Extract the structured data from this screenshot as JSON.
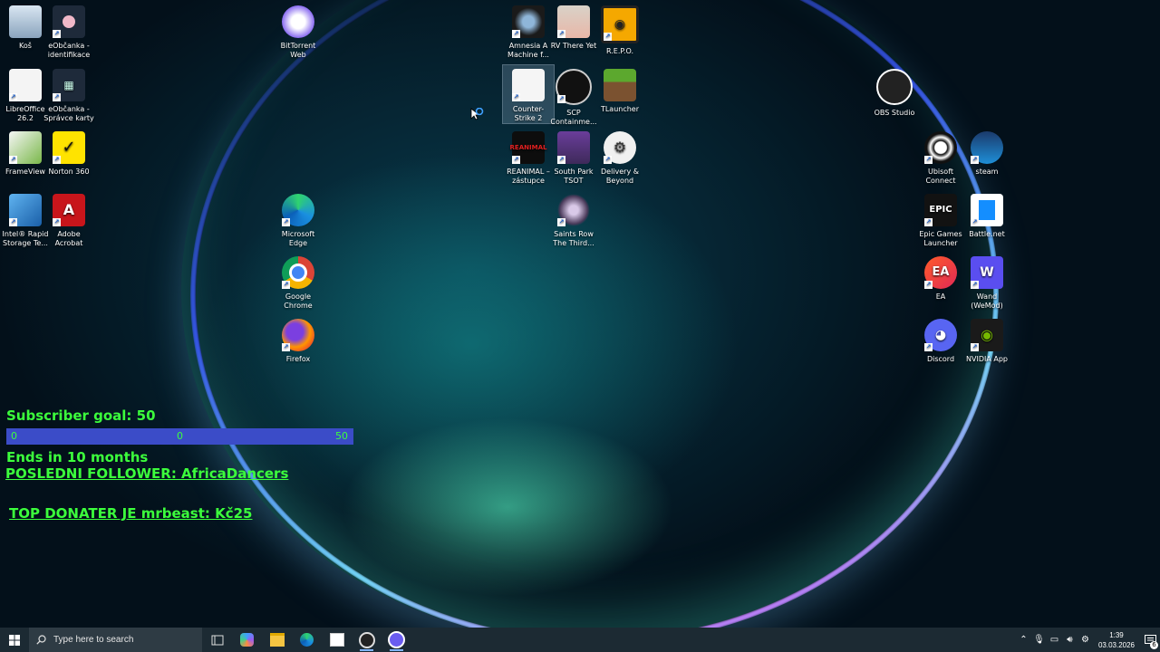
{
  "desktop_icons": [
    {
      "label": "Koš"
    },
    {
      "label": "eObčanka - identifikace"
    },
    {
      "label": "LibreOffice 26.2"
    },
    {
      "label": "eObčanka - Správce karty"
    },
    {
      "label": "FrameView"
    },
    {
      "label": "Norton 360"
    },
    {
      "label": "Intel® Rapid Storage Te..."
    },
    {
      "label": "Adobe Acrobat"
    },
    {
      "label": "BitTorrent Web"
    },
    {
      "label": "Microsoft Edge"
    },
    {
      "label": "Google Chrome"
    },
    {
      "label": "Firefox"
    },
    {
      "label": "Amnesia A Machine f..."
    },
    {
      "label": "RV There Yet"
    },
    {
      "label": "R.E.P.O."
    },
    {
      "label": "Counter-Strike 2"
    },
    {
      "label": "SCP Containme..."
    },
    {
      "label": "TLauncher"
    },
    {
      "label": "REANIMAL – zástupce"
    },
    {
      "label": "South Park TSOT"
    },
    {
      "label": "Delivery & Beyond"
    },
    {
      "label": "Saints Row The Third..."
    },
    {
      "label": "OBS Studio"
    },
    {
      "label": "Ubisoft Connect"
    },
    {
      "label": "steam"
    },
    {
      "label": "Epic Games Launcher"
    },
    {
      "label": "Battle.net"
    },
    {
      "label": "EA"
    },
    {
      "label": "Wand (WeMod)"
    },
    {
      "label": "Discord"
    },
    {
      "label": "NVIDIA App"
    }
  ],
  "overlay": {
    "subscriber_goal": "Subscriber goal: 50",
    "bar_left": "0",
    "bar_mid": "0",
    "bar_right": "50",
    "ends_in": "Ends in 10 months",
    "last_follower": "POSLEDNI FOLLOWER: AfricaDancers",
    "top_donater": "TOP DONATER JE mrbeast: Kč25"
  },
  "taskbar": {
    "search_placeholder": "Type here to search",
    "time": "1:39",
    "date": "03.03.2026",
    "notification_count": "6"
  },
  "colors": {
    "overlay_text": "#3cff3c",
    "goal_bar": "#3b4cc8",
    "taskbar": "#1c2a33"
  }
}
